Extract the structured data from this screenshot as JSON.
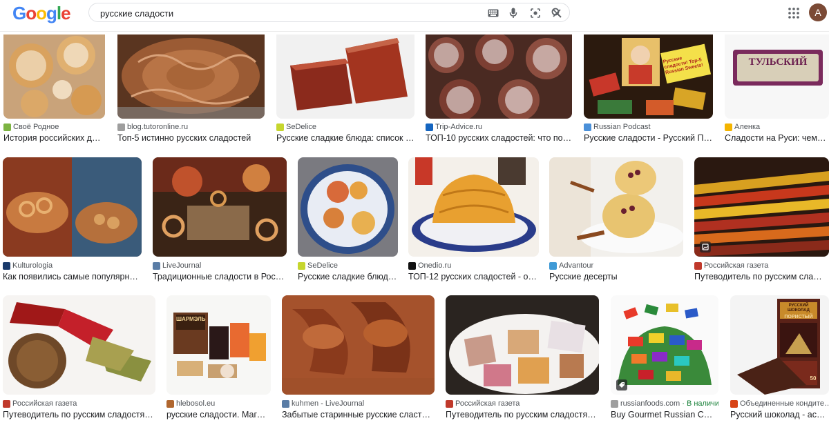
{
  "header": {
    "logo_letters": [
      {
        "ch": "G",
        "color": "#4285F4"
      },
      {
        "ch": "o",
        "color": "#EA4335"
      },
      {
        "ch": "o",
        "color": "#FBBC05"
      },
      {
        "ch": "g",
        "color": "#4285F4"
      },
      {
        "ch": "l",
        "color": "#34A853"
      },
      {
        "ch": "e",
        "color": "#EA4335"
      }
    ],
    "query": "русские сладости",
    "avatar_letter": "A"
  },
  "row1": [
    {
      "source": "Своё Родное",
      "title": "История российских дес…",
      "fav": "#7cb342"
    },
    {
      "source": "blog.tutoronline.ru",
      "title": "Топ-5 истинно русских сладостей",
      "fav": "#9e9e9e"
    },
    {
      "source": "SeDelice",
      "title": "Русские сладкие блюда: список н…",
      "fav": "#c6d62e"
    },
    {
      "source": "Trip-Advice.ru",
      "title": "ТОП-10 русских сладостей: что поп…",
      "fav": "#1565c0"
    },
    {
      "source": "Russian Podcast",
      "title": "Русские сладости - Русский По…",
      "fav": "#4a90d9"
    },
    {
      "source": "Аленка",
      "title": "Сладости на Руси: чем …",
      "fav": "#f4b400"
    }
  ],
  "row2": [
    {
      "source": "Kulturologia",
      "title": "Как появились самые популярны…",
      "fav": "#1a3a6b"
    },
    {
      "source": "LiveJournal",
      "title": "Традиционные сладости в России",
      "fav": "#5a7da6"
    },
    {
      "source": "SeDelice",
      "title": "Русские сладкие блюд…",
      "fav": "#c6d62e"
    },
    {
      "source": "Onedio.ru",
      "title": "ТОП-12 русских сладостей - one…",
      "fav": "#111111"
    },
    {
      "source": "Advantour",
      "title": "Русские десерты",
      "fav": "#3f9ad6"
    },
    {
      "source": "Российская газета",
      "title": "Путеводитель по русским сладо…",
      "fav": "#c0392b"
    }
  ],
  "row3": [
    {
      "source": "Российская газета",
      "title": "Путеводитель по русским сладостям …",
      "fav": "#c0392b"
    },
    {
      "source": "hlebosol.eu",
      "title": "русские сладости. Мага…",
      "fav": "#b0662e"
    },
    {
      "source": "kuhmen - LiveJournal",
      "title": "Забытые старинные русские сласти: …",
      "fav": "#5a7da6"
    },
    {
      "source": "Российская газета",
      "title": "Путеводитель по русским сладостям …",
      "fav": "#c0392b"
    },
    {
      "source": "russianfoods.com",
      "instock": "· В наличии",
      "title": "Buy Gourmet Russian Cho…",
      "fav": "#9e9e9e"
    },
    {
      "source": "Объединенные кондите…",
      "title": "Русский шоколад - асс…",
      "fav": "#d84315"
    }
  ],
  "thumb_text": {
    "tulsky": "ТУЛЬСКИЙ",
    "choco_brand": "РУССКИЙ ШОКОЛАД",
    "choco_name": "ПОРИСТЫЙ",
    "choco_weight": "50",
    "sharmel": "ШАРМЭЛЬ",
    "podcast_sign": "Русские сладости! Top-5 Russian Sweets!"
  }
}
